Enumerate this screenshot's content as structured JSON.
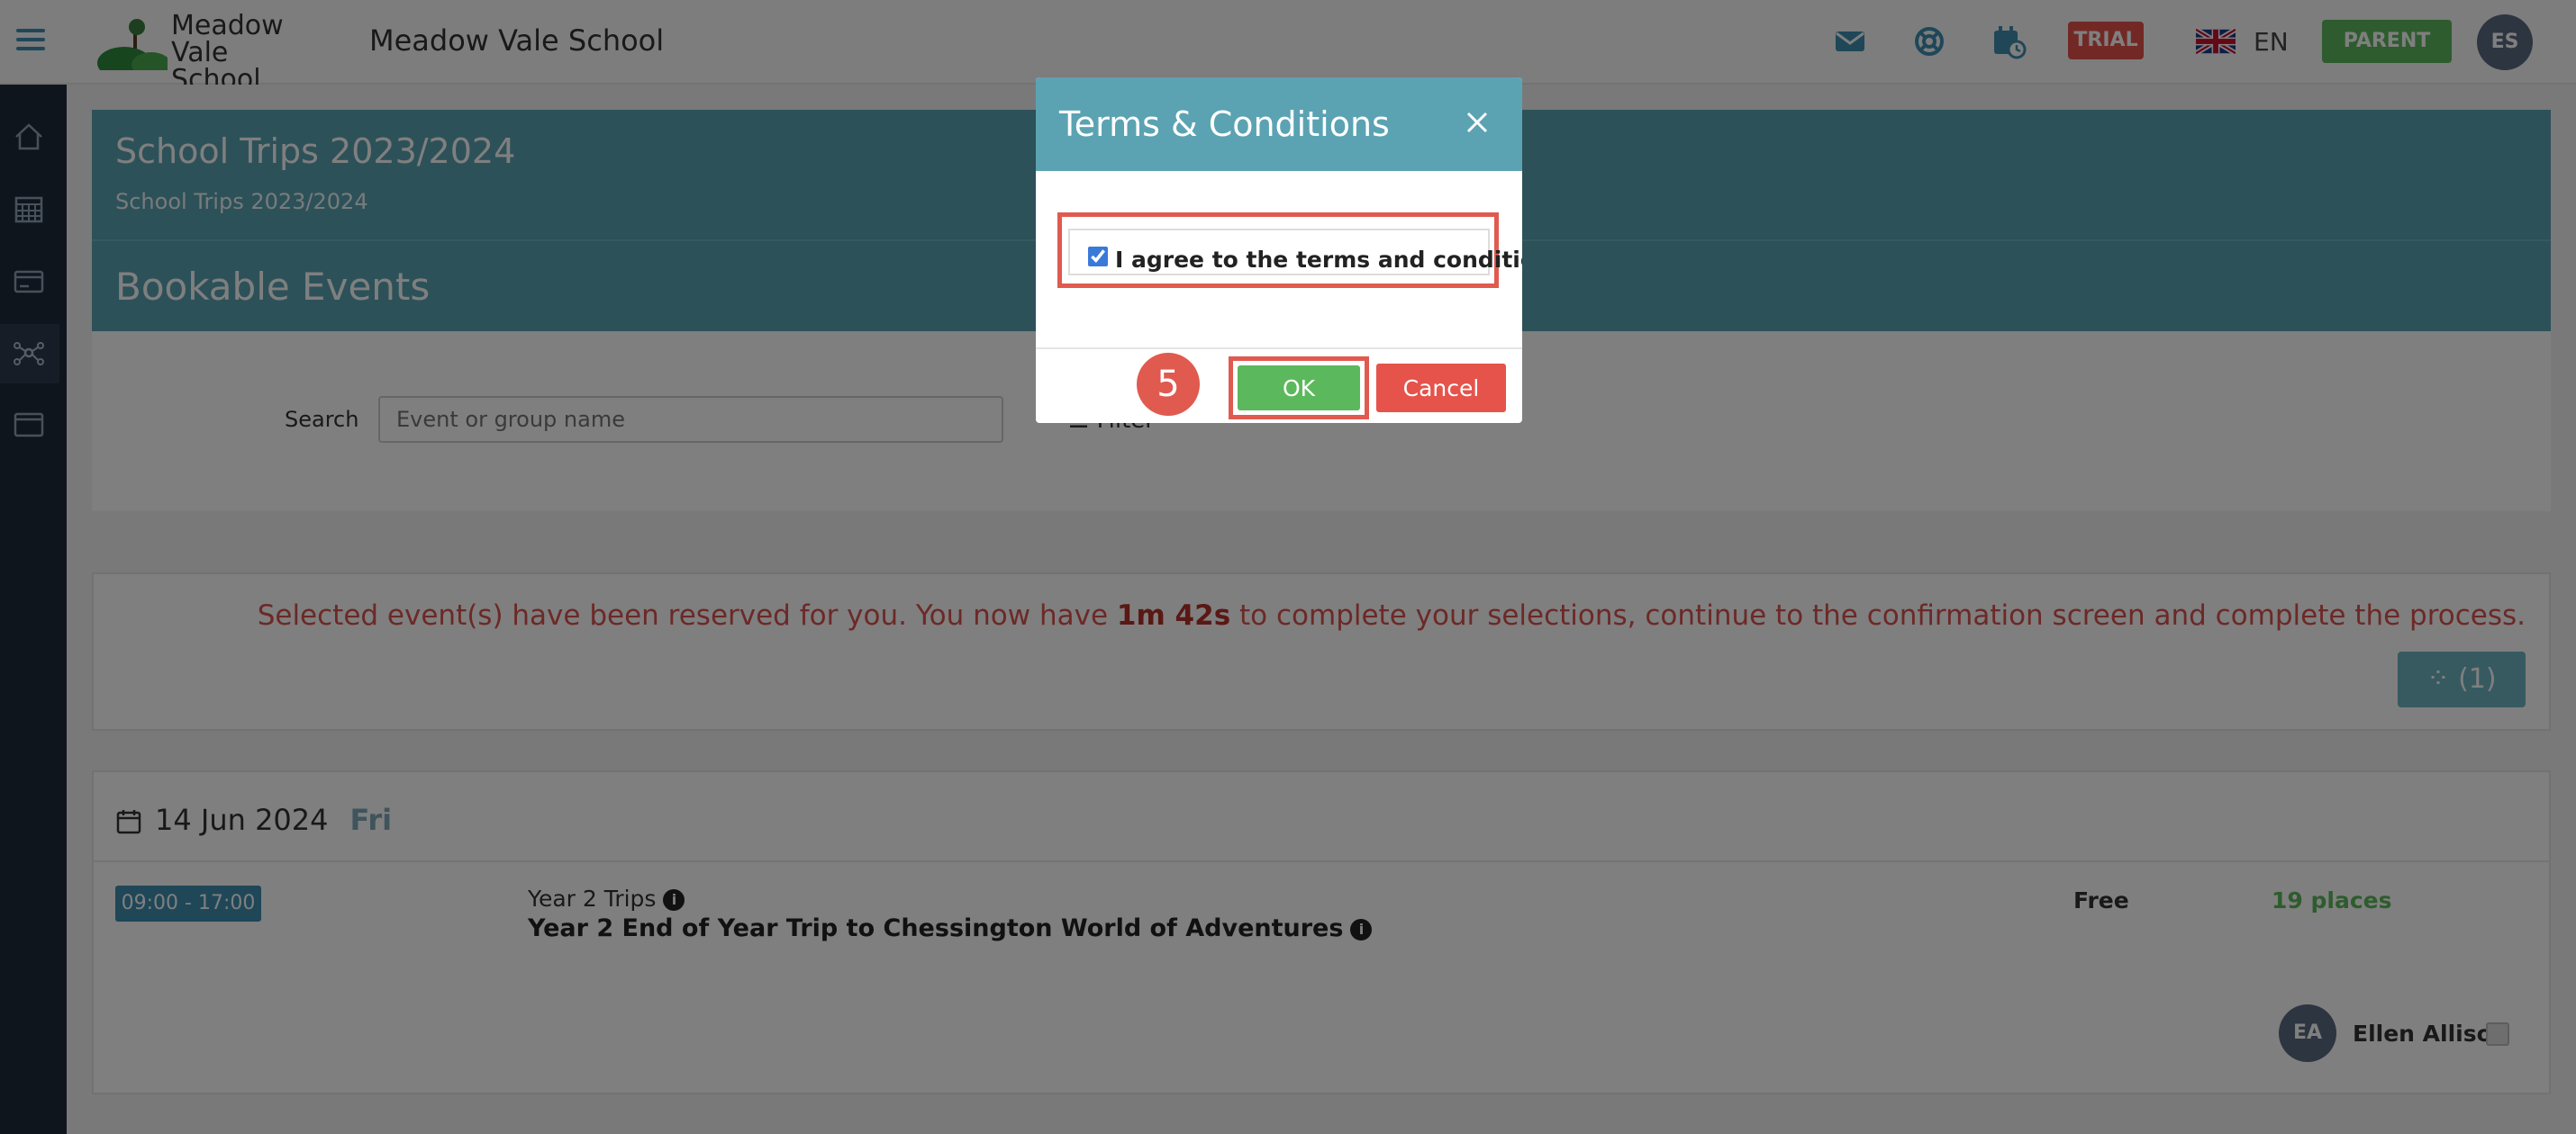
{
  "header": {
    "logo_line1": "Meadow",
    "logo_line2": "Vale School",
    "school_name": "Meadow Vale School",
    "trial_badge": "TRIAL",
    "language": "EN",
    "role_button": "PARENT",
    "user_initials": "ES",
    "icons": [
      "mail-icon",
      "support-icon",
      "calendar-clock-icon",
      "uk-flag-icon"
    ]
  },
  "sidebar": {
    "items": [
      {
        "icon": "home-icon"
      },
      {
        "icon": "calendar-icon"
      },
      {
        "icon": "payments-icon"
      },
      {
        "icon": "network-icon",
        "active": true
      },
      {
        "icon": "window-icon"
      }
    ]
  },
  "page": {
    "title": "School Trips 2023/2024",
    "breadcrumb": "School Trips 2023/2024",
    "section_title": "Bookable Events"
  },
  "search": {
    "label": "Search",
    "placeholder": "Event or group name",
    "filter_label": "Filter"
  },
  "reservation_notice": {
    "text_before": "Selected event(s) have been reserved for you. You now have ",
    "time_left": "1m 42s",
    "text_after": " to complete your selections, continue to the confirmation screen and complete the process.",
    "basket_label": "(1)"
  },
  "event": {
    "date": "14 Jun 2024",
    "day": "Fri",
    "time": "09:00  - 17:00",
    "group": "Year 2 Trips",
    "name": "Year 2 End of Year Trip to Chessington World of Adventures",
    "price": "Free",
    "places": "19 places",
    "student_initials": "EA",
    "student_name": "Ellen Allison"
  },
  "modal": {
    "title": "Terms & Conditions",
    "agree_label": "I agree to the terms and conditions",
    "agree_checked": true,
    "step_number": "5",
    "ok_label": "OK",
    "cancel_label": "Cancel"
  },
  "colors": {
    "accent_teal": "#5ba3b3",
    "sidebar_dark": "#1e2a38",
    "ok_green": "#5cb85c",
    "cancel_red": "#e5534b",
    "highlight_red": "#e05a4f"
  }
}
